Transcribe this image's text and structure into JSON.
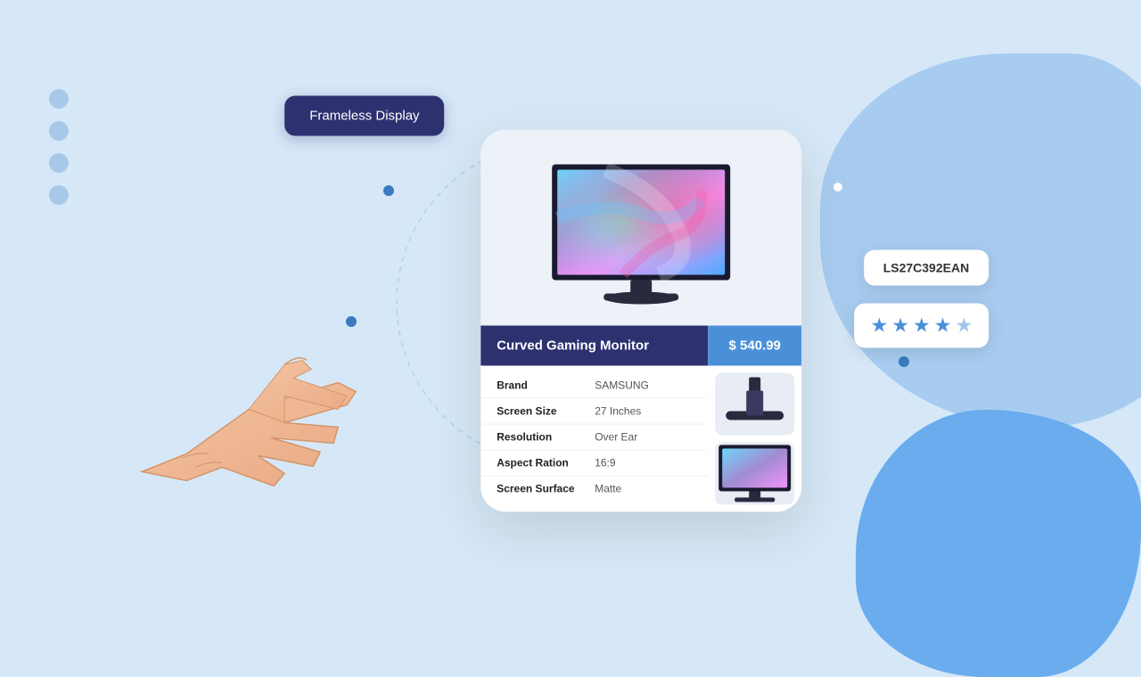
{
  "background": {
    "color": "#d6e8f7"
  },
  "tag": {
    "frameless_display": "Frameless Display"
  },
  "product": {
    "model": "LS27C392EAN",
    "title": "Curved Gaming Monitor",
    "price": "$ 540.99",
    "rating": 4.5,
    "specs": [
      {
        "label": "Brand",
        "value": "SAMSUNG"
      },
      {
        "label": "Screen Size",
        "value": "27 Inches"
      },
      {
        "label": "Resolution",
        "value": "Over Ear"
      },
      {
        "label": "Aspect Ration",
        "value": "16:9"
      },
      {
        "label": "Screen Surface",
        "value": "Matte"
      }
    ]
  },
  "stars": [
    "★",
    "★",
    "★",
    "★",
    "☆"
  ],
  "dots": [
    "●",
    "●",
    "●",
    "●"
  ]
}
